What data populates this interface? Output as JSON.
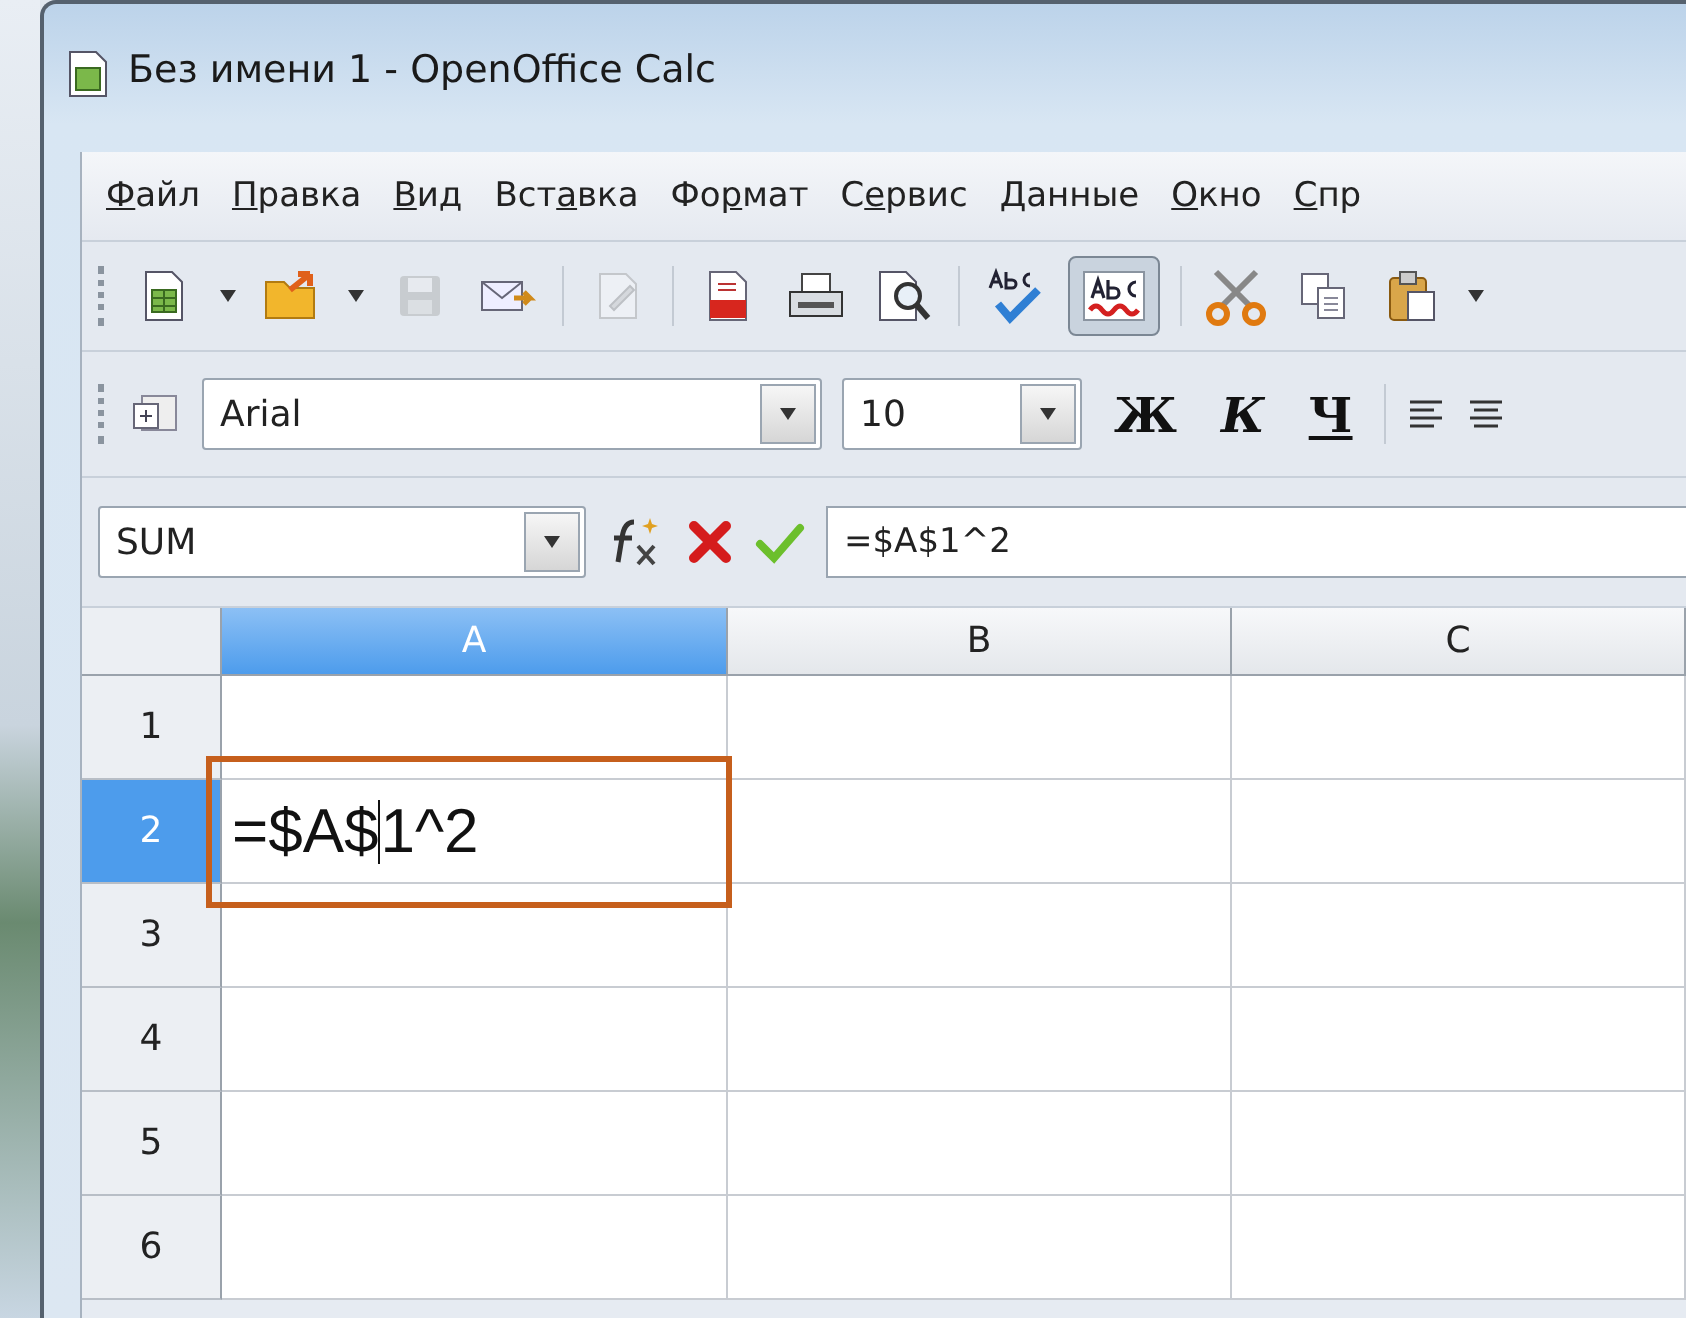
{
  "window": {
    "title": "Без имени 1 - OpenOffice Calc"
  },
  "menu": [
    {
      "key": "Ф",
      "after": "айл"
    },
    {
      "key": "П",
      "after": "равка"
    },
    {
      "key": "В",
      "after": "ид"
    },
    {
      "before": "Вст",
      "key": "а",
      "after": "вка"
    },
    {
      "before": "Фо",
      "key": "р",
      "after": "мат"
    },
    {
      "before": "С",
      "key": "е",
      "after": "рвис"
    },
    {
      "key": "Д",
      "after": "анные"
    },
    {
      "key": "О",
      "after": "кно"
    },
    {
      "key": "С",
      "after": "пр"
    }
  ],
  "toolbar": [
    {
      "kind": "new",
      "disabled": false,
      "pressed": false,
      "has_menu": true,
      "group_end": false
    },
    {
      "kind": "open",
      "disabled": false,
      "pressed": false,
      "has_menu": true,
      "group_end": false
    },
    {
      "kind": "save",
      "disabled": true,
      "pressed": false,
      "has_menu": false,
      "group_end": false
    },
    {
      "kind": "mail",
      "disabled": false,
      "pressed": false,
      "has_menu": false,
      "group_end": true
    },
    {
      "kind": "edit",
      "disabled": true,
      "pressed": false,
      "has_menu": false,
      "group_end": true
    },
    {
      "kind": "pdf",
      "disabled": false,
      "pressed": false,
      "has_menu": false,
      "group_end": false
    },
    {
      "kind": "print",
      "disabled": false,
      "pressed": false,
      "has_menu": false,
      "group_end": false
    },
    {
      "kind": "preview",
      "disabled": false,
      "pressed": false,
      "has_menu": false,
      "group_end": true
    },
    {
      "kind": "spell",
      "disabled": false,
      "pressed": false,
      "has_menu": false,
      "group_end": false
    },
    {
      "kind": "autospell",
      "disabled": false,
      "pressed": true,
      "has_menu": false,
      "group_end": true
    },
    {
      "kind": "cut",
      "disabled": false,
      "pressed": false,
      "has_menu": false,
      "group_end": false
    },
    {
      "kind": "copy",
      "disabled": false,
      "pressed": false,
      "has_menu": false,
      "group_end": false
    },
    {
      "kind": "paste",
      "disabled": false,
      "pressed": false,
      "has_menu": true,
      "group_end": false
    }
  ],
  "format_bar": {
    "font": "Arial",
    "size": "10",
    "styles": [
      {
        "kind": "bold",
        "label": "Ж"
      },
      {
        "kind": "italic",
        "label": "К"
      },
      {
        "kind": "underline",
        "label": "Ч"
      }
    ]
  },
  "formula_bar": {
    "name_box": "SUM",
    "formula": "=$A$1^2"
  },
  "sheet": {
    "columns": [
      {
        "label": "A",
        "selected": true
      },
      {
        "label": "B",
        "selected": false
      },
      {
        "label": "C",
        "selected": false
      }
    ],
    "rows": [
      {
        "label": "1",
        "selected": false,
        "editing": false
      },
      {
        "label": "2",
        "selected": true,
        "editing": true,
        "text_before_cursor": "=$A$",
        "text_after_cursor": "1^2",
        "highlighted": true
      },
      {
        "label": "3",
        "selected": false,
        "editing": false
      },
      {
        "label": "4",
        "selected": false,
        "editing": false
      },
      {
        "label": "5",
        "selected": false,
        "editing": false
      },
      {
        "label": "6",
        "selected": false,
        "editing": false
      }
    ]
  }
}
